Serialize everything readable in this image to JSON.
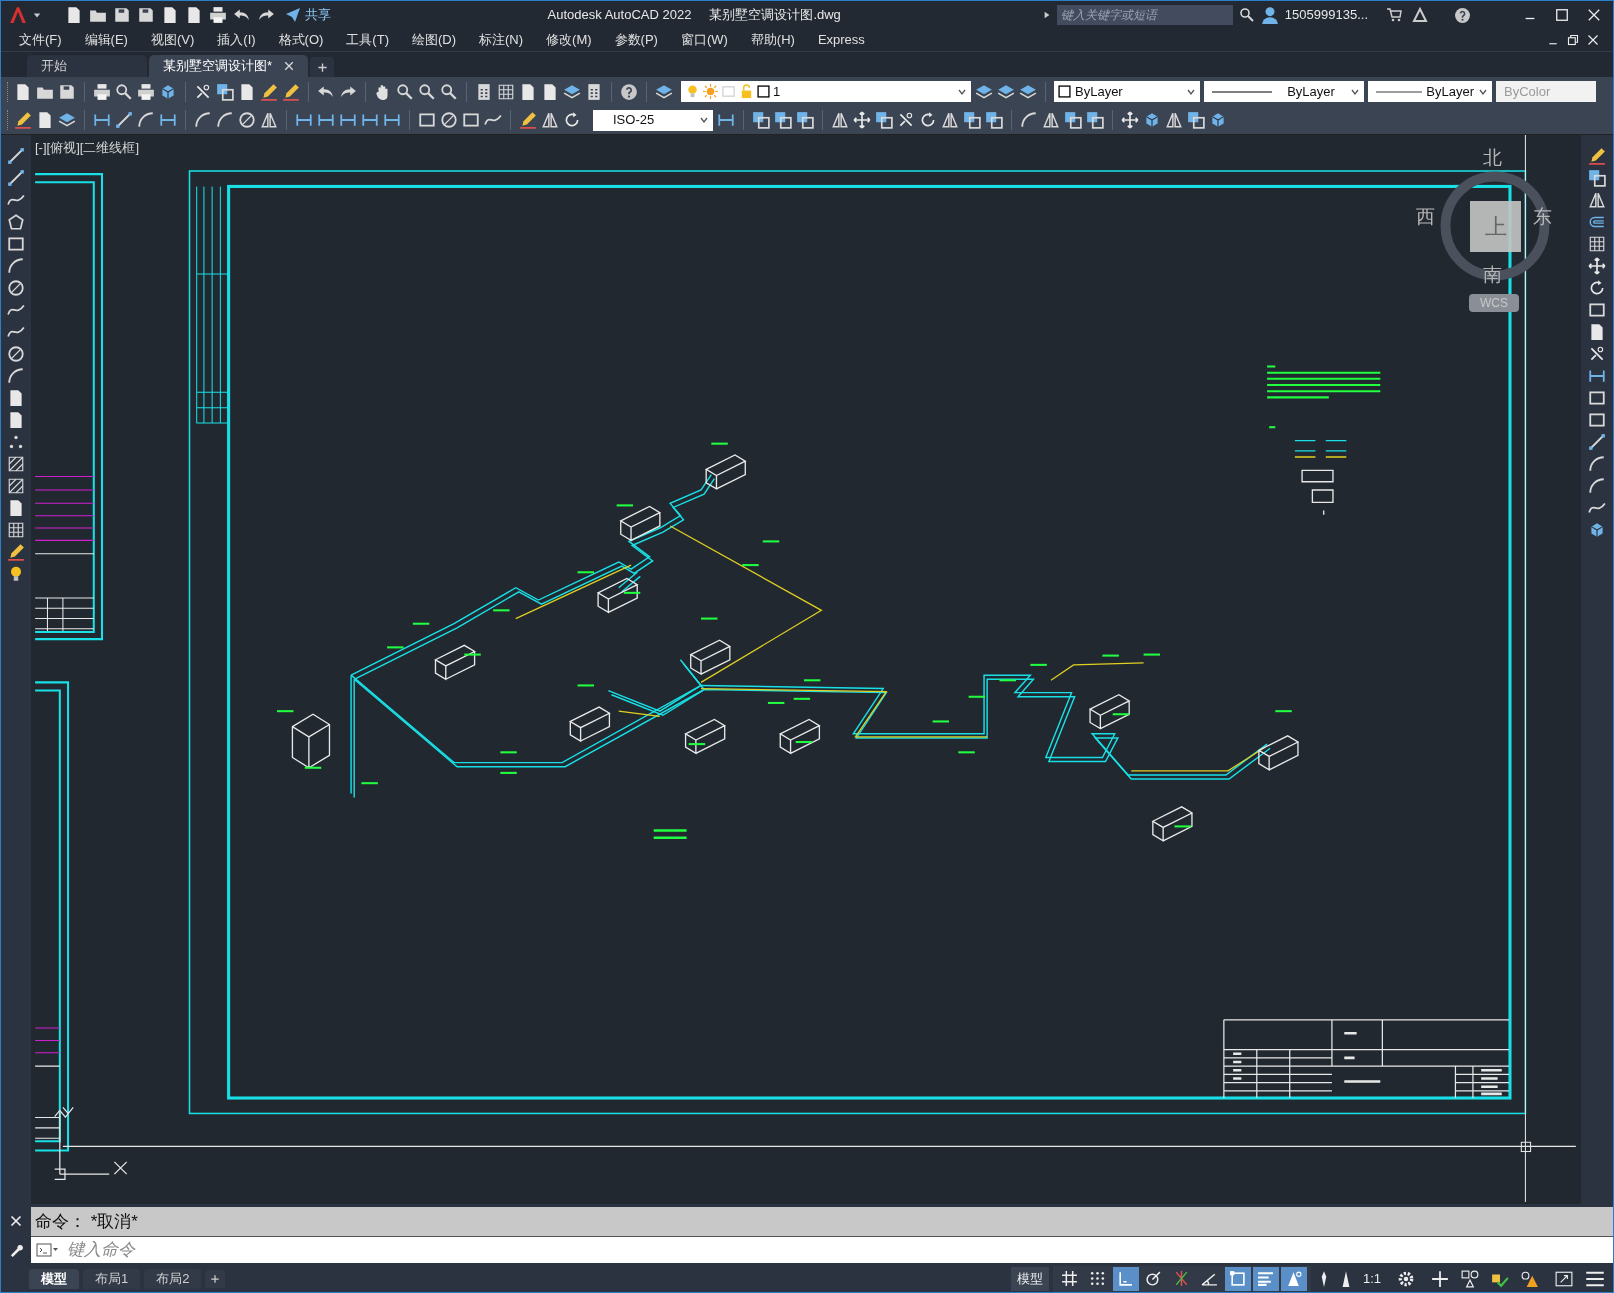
{
  "title_bar": {
    "share_label": "共享",
    "app_title": "Autodesk AutoCAD 2022",
    "file_name": "某别墅空调设计图.dwg",
    "search": {
      "placeholder": "键入关键字或短语"
    },
    "user": "1505999135..."
  },
  "menu": [
    "文件(F)",
    "编辑(E)",
    "视图(V)",
    "插入(I)",
    "格式(O)",
    "工具(T)",
    "绘图(D)",
    "标注(N)",
    "修改(M)",
    "参数(P)",
    "窗口(W)",
    "帮助(H)",
    "Express"
  ],
  "file_tabs": [
    {
      "label": "开始",
      "selected": false
    },
    {
      "label": "某别墅空调设计图*",
      "selected": true
    }
  ],
  "properties_toolbar": {
    "layer": "1",
    "dimension_style": "ISO-25",
    "color_control": "ByLayer",
    "linetype": "ByLayer",
    "lineweight": "ByLayer",
    "plot_style": "ByColor"
  },
  "viewport": {
    "label": "[-][俯视][二维线框]",
    "viewcube": {
      "north": "北",
      "south": "南",
      "east": "东",
      "west": "西",
      "face": "上",
      "ucs": "WCS"
    }
  },
  "command_line": {
    "history": "命令： *取消*",
    "placeholder": "键入命令"
  },
  "layout_tabs": [
    {
      "label": "模型",
      "selected": true
    },
    {
      "label": "布局1",
      "selected": false
    },
    {
      "label": "布局2",
      "selected": false
    }
  ],
  "status_bar": {
    "space": "模型",
    "scale": "1:1",
    "toggles": [
      {
        "kind": "grid",
        "on": false
      },
      {
        "kind": "snap",
        "on": false
      },
      {
        "kind": "ortho",
        "on": true
      },
      {
        "kind": "polar",
        "on": false
      },
      {
        "kind": "isodraft",
        "on": false
      },
      {
        "kind": "angle",
        "on": false
      },
      {
        "kind": "osnap",
        "on": true
      },
      {
        "kind": "lineweight",
        "on": true
      },
      {
        "kind": "annotation",
        "on": true
      }
    ]
  }
}
